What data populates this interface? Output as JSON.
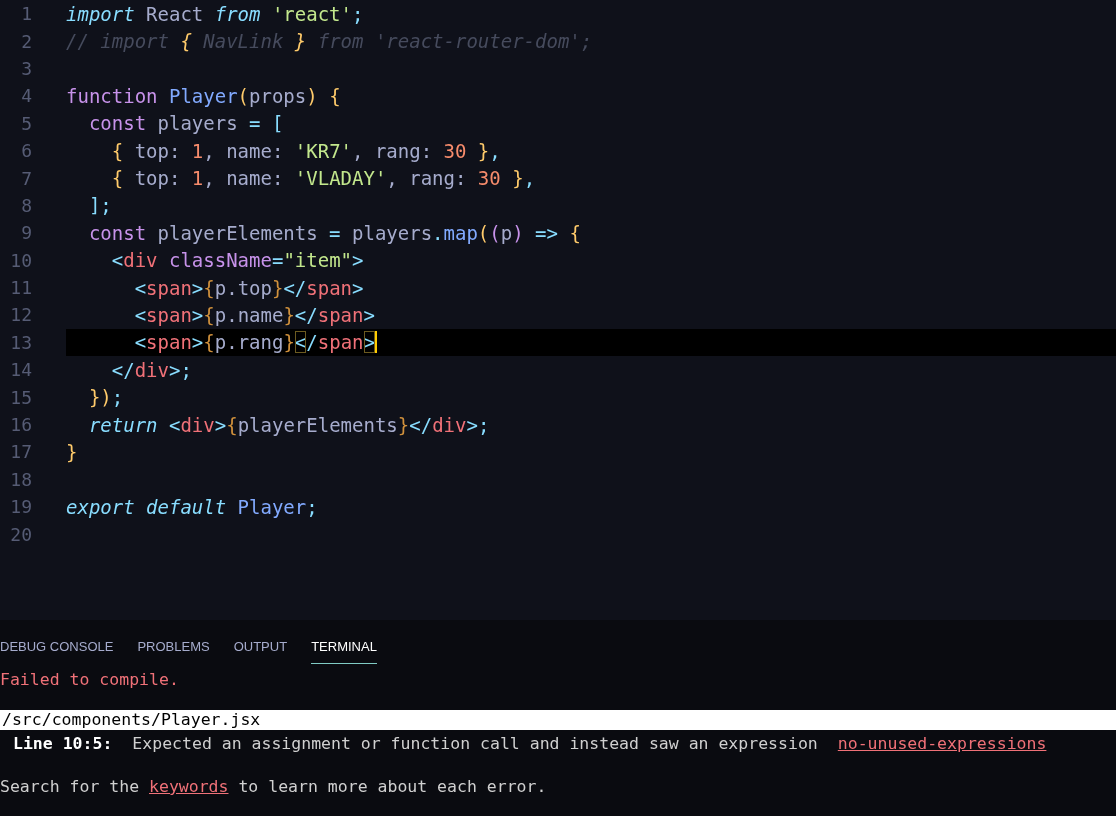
{
  "editor": {
    "lines": [
      {
        "number": "1",
        "current": false,
        "tokens": [
          {
            "kind": "keyword-italic",
            "text": "import"
          },
          {
            "kind": "text",
            "text": " React "
          },
          {
            "kind": "keyword-italic",
            "text": "from"
          },
          {
            "kind": "string",
            "text": " 'react'"
          },
          {
            "kind": "punct",
            "text": ";"
          }
        ]
      },
      {
        "number": "2",
        "current": false,
        "tokens": [
          {
            "kind": "comment",
            "text": "// import "
          },
          {
            "kind": "comment-brace",
            "text": "{"
          },
          {
            "kind": "comment",
            "text": " NavLink "
          },
          {
            "kind": "comment-brace",
            "text": "}"
          },
          {
            "kind": "comment",
            "text": " from 'react-router-dom';"
          }
        ]
      },
      {
        "number": "3",
        "current": false
      },
      {
        "number": "4",
        "current": false,
        "tokens": [
          {
            "kind": "keyword",
            "text": "function"
          },
          {
            "kind": "function",
            "text": " Player"
          },
          {
            "kind": "paren",
            "text": "("
          },
          {
            "kind": "text",
            "text": "props"
          },
          {
            "kind": "paren",
            "text": ")"
          },
          {
            "kind": "brace",
            "text": " {"
          }
        ]
      },
      {
        "number": "5",
        "current": false,
        "tokens": [
          {
            "kind": "keyword",
            "text": "  const"
          },
          {
            "kind": "text",
            "text": " players "
          },
          {
            "kind": "punct",
            "text": "= ["
          }
        ]
      },
      {
        "number": "6",
        "current": false,
        "tokens": [
          {
            "kind": "brace",
            "text": "    {"
          },
          {
            "kind": "text",
            "text": " top: "
          },
          {
            "kind": "number",
            "text": "1"
          },
          {
            "kind": "text",
            "text": ", name: "
          },
          {
            "kind": "string",
            "text": "'KR7'"
          },
          {
            "kind": "text",
            "text": ", rang: "
          },
          {
            "kind": "number",
            "text": "30"
          },
          {
            "kind": "brace",
            "text": " }"
          },
          {
            "kind": "punct",
            "text": ","
          }
        ]
      },
      {
        "number": "7",
        "current": false,
        "tokens": [
          {
            "kind": "brace",
            "text": "    {"
          },
          {
            "kind": "text",
            "text": " top: "
          },
          {
            "kind": "number",
            "text": "1"
          },
          {
            "kind": "text",
            "text": ", name: "
          },
          {
            "kind": "string",
            "text": "'VLADAY'"
          },
          {
            "kind": "text",
            "text": ", rang: "
          },
          {
            "kind": "number",
            "text": "30"
          },
          {
            "kind": "brace",
            "text": " }"
          },
          {
            "kind": "punct",
            "text": ","
          }
        ]
      },
      {
        "number": "8",
        "current": false,
        "tokens": [
          {
            "kind": "punct",
            "text": "  ];"
          }
        ]
      },
      {
        "number": "9",
        "current": false,
        "tokens": [
          {
            "kind": "keyword",
            "text": "  const"
          },
          {
            "kind": "text",
            "text": " playerElements "
          },
          {
            "kind": "punct",
            "text": "="
          },
          {
            "kind": "text",
            "text": " players"
          },
          {
            "kind": "punct",
            "text": "."
          },
          {
            "kind": "function",
            "text": "map"
          },
          {
            "kind": "paren",
            "text": "("
          },
          {
            "kind": "paren2",
            "text": "("
          },
          {
            "kind": "text",
            "text": "p"
          },
          {
            "kind": "paren2",
            "text": ")"
          },
          {
            "kind": "punct",
            "text": " =>"
          },
          {
            "kind": "brace",
            "text": " {"
          }
        ]
      },
      {
        "number": "10",
        "current": false,
        "tokens": [
          {
            "kind": "punct",
            "text": "    <"
          },
          {
            "kind": "tag",
            "text": "div"
          },
          {
            "kind": "attr",
            "text": " className"
          },
          {
            "kind": "punct",
            "text": "="
          },
          {
            "kind": "string",
            "text": "\"item\""
          },
          {
            "kind": "punct",
            "text": ">"
          }
        ]
      },
      {
        "number": "11",
        "current": false,
        "tokens": [
          {
            "kind": "punct",
            "text": "      <"
          },
          {
            "kind": "tag",
            "text": "span"
          },
          {
            "kind": "punct",
            "text": ">"
          },
          {
            "kind": "jsx-brace",
            "text": "{"
          },
          {
            "kind": "text",
            "text": "p.top"
          },
          {
            "kind": "jsx-brace",
            "text": "}"
          },
          {
            "kind": "punct",
            "text": "</"
          },
          {
            "kind": "tag",
            "text": "span"
          },
          {
            "kind": "punct",
            "text": ">"
          }
        ]
      },
      {
        "number": "12",
        "current": false,
        "tokens": [
          {
            "kind": "punct",
            "text": "      <"
          },
          {
            "kind": "tag",
            "text": "span"
          },
          {
            "kind": "punct",
            "text": ">"
          },
          {
            "kind": "jsx-brace",
            "text": "{"
          },
          {
            "kind": "text",
            "text": "p.name"
          },
          {
            "kind": "jsx-brace",
            "text": "}"
          },
          {
            "kind": "punct",
            "text": "</"
          },
          {
            "kind": "tag",
            "text": "span"
          },
          {
            "kind": "punct",
            "text": ">"
          }
        ]
      },
      {
        "number": "13",
        "current": true,
        "tokens": [
          {
            "kind": "punct",
            "text": "      <"
          },
          {
            "kind": "tag",
            "text": "span"
          },
          {
            "kind": "punct",
            "text": ">"
          },
          {
            "kind": "jsx-brace",
            "text": "{"
          },
          {
            "kind": "text",
            "text": "p.rang"
          },
          {
            "kind": "jsx-brace",
            "text": "}"
          },
          {
            "kind": "match",
            "text": "<"
          },
          {
            "kind": "punct",
            "text": "/"
          },
          {
            "kind": "tag",
            "text": "span"
          },
          {
            "kind": "match",
            "text": ">"
          }
        ]
      },
      {
        "number": "14",
        "current": false,
        "tokens": [
          {
            "kind": "punct",
            "text": "    </"
          },
          {
            "kind": "tag",
            "text": "div"
          },
          {
            "kind": "punct",
            "text": ">;"
          }
        ]
      },
      {
        "number": "15",
        "current": false,
        "tokens": [
          {
            "kind": "brace",
            "text": "  }"
          },
          {
            "kind": "paren",
            "text": ")"
          },
          {
            "kind": "punct",
            "text": ";"
          }
        ]
      },
      {
        "number": "16",
        "current": false,
        "tokens": [
          {
            "kind": "keyword-italic",
            "text": "  return"
          },
          {
            "kind": "punct",
            "text": " <"
          },
          {
            "kind": "tag",
            "text": "div"
          },
          {
            "kind": "punct",
            "text": ">"
          },
          {
            "kind": "jsx-brace",
            "text": "{"
          },
          {
            "kind": "text",
            "text": "playerElements"
          },
          {
            "kind": "jsx-brace",
            "text": "}"
          },
          {
            "kind": "punct",
            "text": "</"
          },
          {
            "kind": "tag",
            "text": "div"
          },
          {
            "kind": "punct",
            "text": ">;"
          }
        ]
      },
      {
        "number": "17",
        "current": false,
        "tokens": [
          {
            "kind": "brace",
            "text": "}"
          }
        ]
      },
      {
        "number": "18",
        "current": false
      },
      {
        "number": "19",
        "current": false,
        "tokens": [
          {
            "kind": "keyword-italic",
            "text": "export default"
          },
          {
            "kind": "function",
            "text": " Player"
          },
          {
            "kind": "punct",
            "text": ";"
          }
        ]
      },
      {
        "number": "20",
        "current": false
      }
    ]
  },
  "panel": {
    "tabs": [
      {
        "label": "DEBUG CONSOLE",
        "selected": false
      },
      {
        "label": "PROBLEMS",
        "selected": false
      },
      {
        "label": "OUTPUT",
        "selected": false
      },
      {
        "label": "TERMINAL",
        "selected": true
      }
    ],
    "terminal": [
      {
        "kind": "error",
        "text": "Failed to compile."
      },
      {
        "kind": "file",
        "text": "/src/components/Player.jsx"
      },
      {
        "kind": "lint",
        "location": "Line 10:5:",
        "message": "Expected an assignment or function call and instead saw an expression",
        "rule": "no-unused-expressions"
      },
      {
        "kind": "hint",
        "before": "Search for the",
        "link": "keywords",
        "after": "to learn more about each error."
      }
    ]
  }
}
